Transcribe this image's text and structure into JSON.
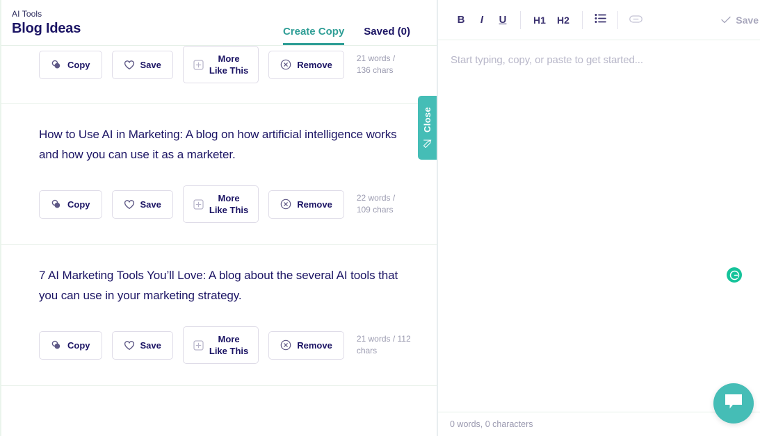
{
  "header": {
    "breadcrumb": "AI Tools",
    "title": "Blog Ideas",
    "tabs": [
      {
        "label": "Create Copy",
        "active": true
      },
      {
        "label": "Saved (0)",
        "active": false
      }
    ]
  },
  "accent_color": "#45bdb6",
  "tab_accent_color": "#2f9e96",
  "close_tab": {
    "label": "Close",
    "icon": "pen-icon"
  },
  "buttons": {
    "copy": "Copy",
    "save": "Save",
    "more_like_this_line1": "More",
    "more_like_this_line2": "Like This",
    "remove": "Remove"
  },
  "cards": [
    {
      "text": "",
      "truncated": true,
      "wordcount_line1": "21 words /",
      "wordcount_line2": "136 chars"
    },
    {
      "text": "How to Use AI in Marketing: A blog on how artificial intelligence works and how you can use it as a marketer.",
      "truncated": false,
      "wordcount_line1": "22 words /",
      "wordcount_line2": "109 chars"
    },
    {
      "text": "7 AI Marketing Tools You’ll Love: A blog about the several AI tools that you can use in your marketing strategy.",
      "truncated": false,
      "wordcount_line1": "21 words / 112",
      "wordcount_line2": "chars"
    }
  ],
  "editor": {
    "toolbar": {
      "bold": "B",
      "italic": "I",
      "underline": "U",
      "h1": "H1",
      "h2": "H2",
      "bullet_list_icon": "bullet-list-icon",
      "link_icon": "link-icon",
      "save_label": "Save"
    },
    "placeholder": "Start typing, copy, or paste to get started...",
    "footer_count": "0 words, 0 characters",
    "grammarly_badge": "G",
    "grammarly_color": "#15c39a"
  },
  "chat": {
    "icon": "chat-bubble-icon"
  }
}
